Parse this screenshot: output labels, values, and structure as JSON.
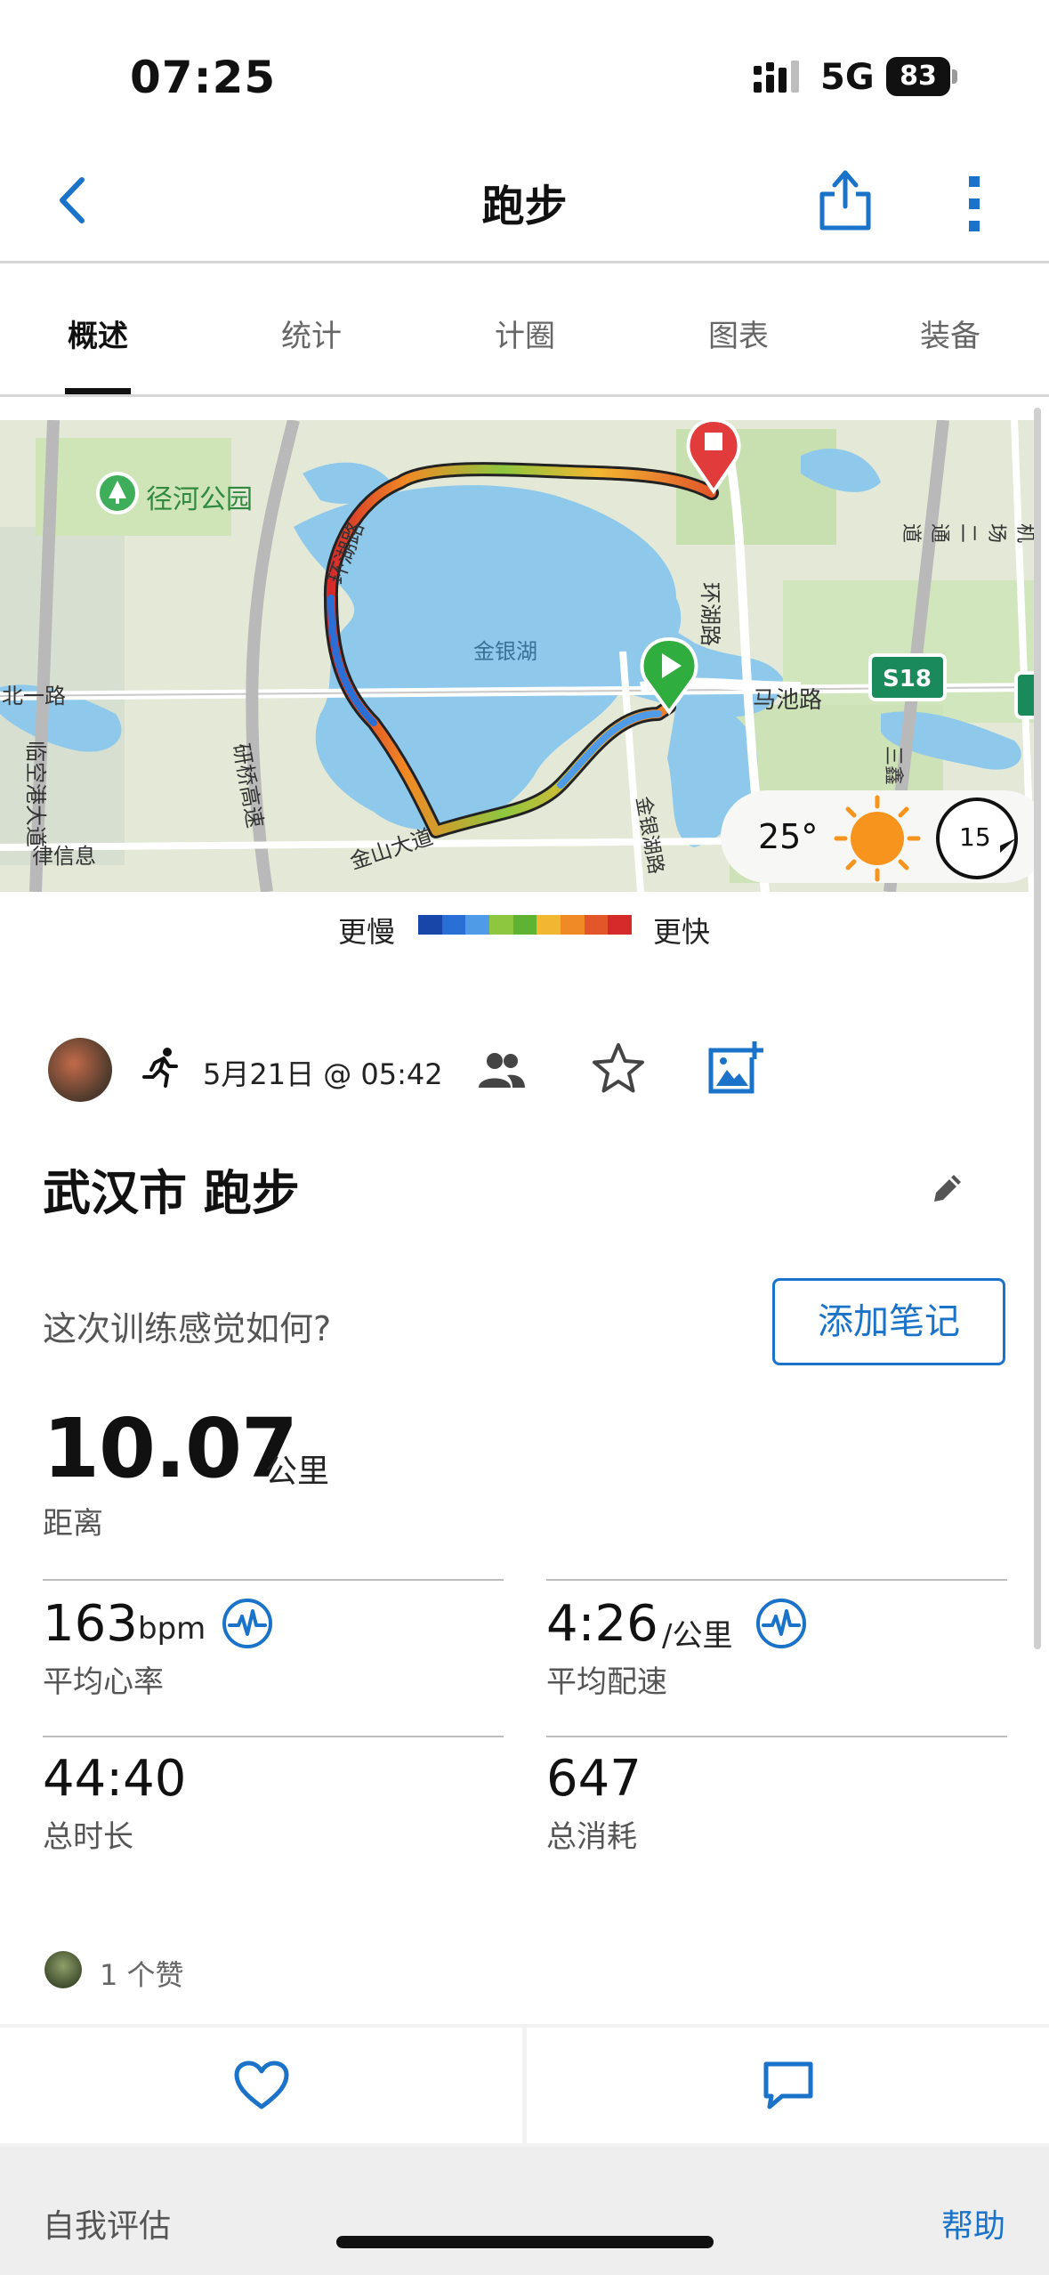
{
  "status_bar": {
    "time": "07:25",
    "network": "5G",
    "battery": "83",
    "battery_level_percent": 83
  },
  "nav": {
    "title": "跑步",
    "icons": [
      "back-chevron-icon",
      "share-icon",
      "more-vertical-icon"
    ]
  },
  "tabs": [
    {
      "label": "概述",
      "active": true
    },
    {
      "label": "统计",
      "active": false
    },
    {
      "label": "计圈",
      "active": false
    },
    {
      "label": "图表",
      "active": false
    },
    {
      "label": "装备",
      "active": false
    }
  ],
  "map": {
    "labels": {
      "park": "径河公园",
      "lake": "金银湖",
      "road_huanhu_left": "环湖路",
      "road_huanhu_right": "环湖路",
      "road_machi": "马池路",
      "road_jinshan": "金山大道",
      "road_jinyinhu": "金银湖路",
      "road_left_edge": "北一路",
      "road_linkong": "临空港大道",
      "road_jianqiao": "研桥高速",
      "road_jichang": "机场二通道",
      "road_xinxi": "律信息",
      "road_sanhu": "三鑫",
      "highway_badge": "S18"
    },
    "weather": {
      "temperature": "25°",
      "wind": "15",
      "icon": "sun-icon"
    }
  },
  "legend": {
    "slow": "更慢",
    "fast": "更快",
    "colors": [
      "#1546a8",
      "#2a6fd6",
      "#4f9be8",
      "#8dc63f",
      "#5fb332",
      "#f2b731",
      "#f08a24",
      "#e2562a",
      "#d42a2a"
    ]
  },
  "activity": {
    "date": "5月21日 @ 05:42",
    "title": "武汉市 跑步",
    "feel_question": "这次训练感觉如何?",
    "add_note": "添加笔记"
  },
  "distance": {
    "value": "10.07",
    "unit": "公里",
    "label": "距离"
  },
  "stats": [
    {
      "value": "163",
      "unit": "bpm",
      "label": "平均心率",
      "icon": "heart-rate-icon"
    },
    {
      "value": "4:26",
      "unit": "/公里",
      "label": "平均配速",
      "icon": "pace-icon"
    },
    {
      "value": "44:40",
      "unit": "",
      "label": "总时长"
    },
    {
      "value": "647",
      "unit": "",
      "label": "总消耗"
    }
  ],
  "likes": {
    "text": "1 个赞"
  },
  "actions": [
    "like-heart-icon",
    "comment-icon"
  ],
  "bottom": {
    "left": "自我评估",
    "right": "帮助"
  },
  "colors": {
    "accent": "#1a73c9",
    "map_water": "#8ec9ec",
    "map_land": "#dfe8d0",
    "start_pin": "#2fae3f",
    "stop_pin": "#e23b3b"
  }
}
